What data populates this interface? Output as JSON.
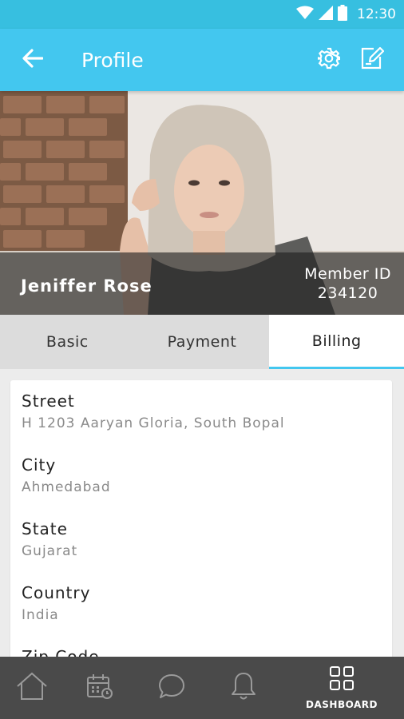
{
  "status_bar": {
    "time": "12:30",
    "icons": [
      "wifi-icon",
      "cell-signal-icon",
      "battery-icon"
    ]
  },
  "app_bar": {
    "title": "Profile",
    "icons": [
      "back-arrow-icon",
      "gear-icon",
      "edit-icon"
    ]
  },
  "profile": {
    "name": "Jeniffer Rose",
    "member_id_label": "Member ID",
    "member_id": "234120"
  },
  "tabs": [
    {
      "label": "Basic",
      "active": false
    },
    {
      "label": "Payment",
      "active": false
    },
    {
      "label": "Billing",
      "active": true
    }
  ],
  "billing": {
    "fields": [
      {
        "label": "Street",
        "value": "H 1203 Aaryan Gloria, South Bopal"
      },
      {
        "label": "City",
        "value": "Ahmedabad"
      },
      {
        "label": "State",
        "value": "Gujarat"
      },
      {
        "label": "Country",
        "value": "India"
      },
      {
        "label": "Zip Code",
        "value": ""
      }
    ]
  },
  "bottom_nav": {
    "items": [
      {
        "icon": "home-icon",
        "label": ""
      },
      {
        "icon": "calendar-icon",
        "label": ""
      },
      {
        "icon": "chat-icon",
        "label": ""
      },
      {
        "icon": "bell-icon",
        "label": ""
      },
      {
        "icon": "dashboard-icon",
        "label": "DASHBOARD",
        "active": true
      }
    ]
  },
  "colors": {
    "primary": "#43c7ef",
    "status_bar": "#37bfe0",
    "bottom_nav": "#4a4a4a",
    "tab_inactive": "#dcdcdc"
  }
}
